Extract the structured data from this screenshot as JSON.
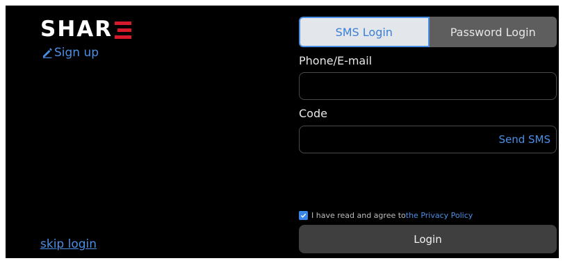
{
  "brand": {
    "logo_text": "SHAR",
    "logo_last_letter": "E",
    "accent_color": "#d7192c"
  },
  "left": {
    "signup_icon": "edit-pencil-icon",
    "signup_label": "Sign up",
    "skip_label": "skip login"
  },
  "tabs": {
    "sms_label": "SMS Login",
    "password_label": "Password Login",
    "active": "SMS Login"
  },
  "form": {
    "phone_label": "Phone/E-mail",
    "phone_value": "",
    "code_label": "Code",
    "code_value": "",
    "send_sms_label": "Send SMS",
    "agree_text": "I have read and agree to",
    "privacy_link": "the Privacy Policy",
    "agree_checked": true,
    "login_label": "Login"
  },
  "colors": {
    "link": "#4a8fe6",
    "background": "#000000"
  }
}
